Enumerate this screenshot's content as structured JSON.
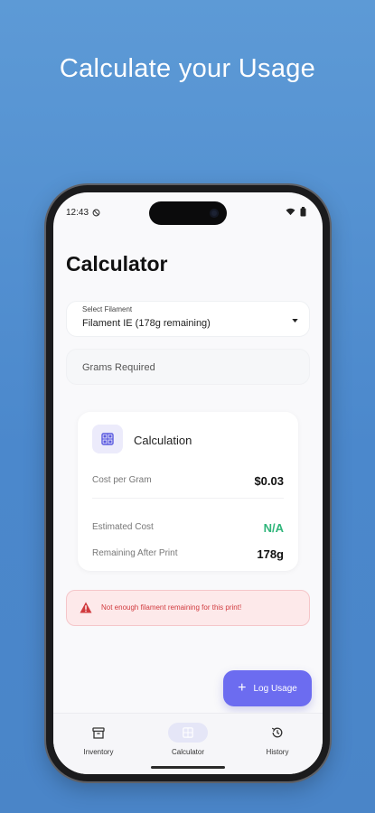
{
  "promo": {
    "headline": "Calculate your Usage"
  },
  "status_bar": {
    "time": "12:43"
  },
  "header": {
    "title": "Calculator"
  },
  "filament_select": {
    "label": "Select Filament",
    "value": "Filament IE (178g remaining)"
  },
  "grams_input": {
    "placeholder": "Grams Required"
  },
  "calculation": {
    "title": "Calculation",
    "cost_per_gram_label": "Cost per Gram",
    "cost_per_gram_value": "$0.03",
    "estimated_cost_label": "Estimated Cost",
    "estimated_cost_value": "N/A",
    "remaining_label": "Remaining After Print",
    "remaining_value": "178g"
  },
  "alert": {
    "message": "Not enough filament remaining for this print!"
  },
  "fab": {
    "label": "Log Usage"
  },
  "nav": {
    "items": [
      {
        "label": "Inventory",
        "icon": "archive-icon"
      },
      {
        "label": "Calculator",
        "icon": "calculator-icon"
      },
      {
        "label": "History",
        "icon": "history-icon"
      }
    ],
    "active": "Calculator"
  },
  "colors": {
    "accent": "#6c6cf0",
    "success": "#2fb57a",
    "error": "#d13b3f",
    "background": "#4b88cc"
  }
}
